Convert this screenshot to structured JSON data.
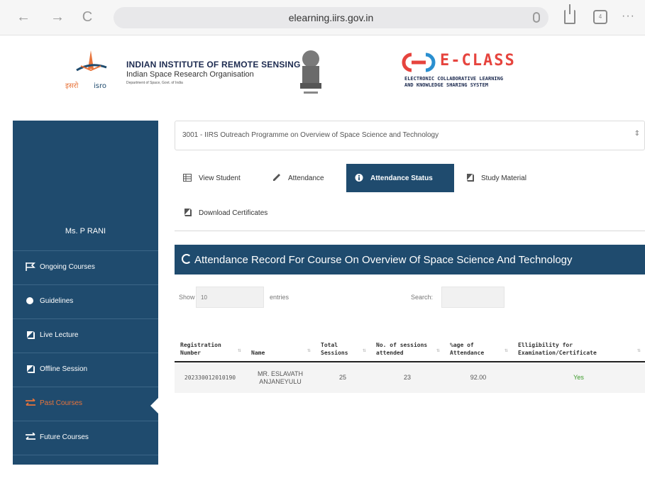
{
  "browser": {
    "url": "elearning.iirs.gov.in",
    "tab_count": "4",
    "back": "←",
    "forward": "→",
    "reload": "C",
    "more": "···"
  },
  "header": {
    "institute_title": "INDIAN INSTITUTE OF REMOTE SENSING",
    "institute_sub": "Indian Space Research Organisation",
    "department": "Department of Space, Govt. of India",
    "eclass_title": "E-CLASS",
    "eclass_sub1": "ELECTRONIC COLLABORATIVE LEARNING",
    "eclass_sub2": "AND KNOWLEDGE SHARING SYSTEM",
    "isro_hindi": "इसरो",
    "isro_word": "isro"
  },
  "sidebar": {
    "user_name": "Ms. P RANI",
    "items": [
      {
        "label": "Ongoing Courses",
        "icon": "flag-icon"
      },
      {
        "label": "Guidelines",
        "icon": "circle-icon"
      },
      {
        "label": "Live Lecture",
        "icon": "book-icon"
      },
      {
        "label": "Offline Session",
        "icon": "book-icon"
      },
      {
        "label": "Past Courses",
        "icon": "exchange-icon"
      },
      {
        "label": "Future Courses",
        "icon": "exchange-icon"
      }
    ]
  },
  "course": {
    "selected": "3001 - IIRS Outreach Programme on Overview of Space Science and Technology",
    "arrow": "⇕"
  },
  "tabs": [
    {
      "label": "View Student"
    },
    {
      "label": "Attendance"
    },
    {
      "label": "Attendance Status"
    },
    {
      "label": "Study Material"
    },
    {
      "label": "Download Certificates"
    }
  ],
  "record": {
    "title": "Attendance Record For Course On Overview Of Space Science And Technology"
  },
  "controls": {
    "show_label": "Show",
    "show_value": "10",
    "entries_label": "entries",
    "search_label": "Search:"
  },
  "table": {
    "headers": [
      "Registration Number",
      "Name",
      "Total Sessions",
      "No. of sessions attended",
      "%age of Attendance",
      "Elligibility for Examination/Certificate"
    ],
    "rows": [
      [
        "202330012010190",
        "MR. ESLAVATH ANJANEYULU",
        "25",
        "23",
        "92.00",
        "Yes"
      ]
    ]
  },
  "colors": {
    "primary": "#1f4b6e",
    "accent": "#e8743b",
    "yes_green": "#3c9b2b",
    "eclass_red": "#e6443e"
  }
}
